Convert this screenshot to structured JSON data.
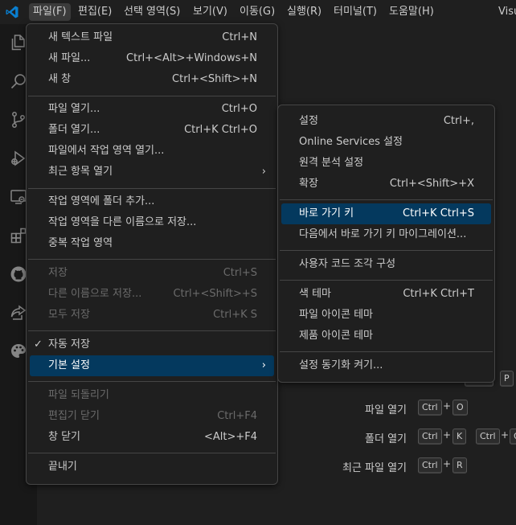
{
  "menubar": {
    "items": [
      "파일(F)",
      "편집(E)",
      "선택 영역(S)",
      "보기(V)",
      "이동(G)",
      "실행(R)",
      "터미널(T)",
      "도움말(H)"
    ],
    "window_title": "Visu"
  },
  "file_menu": {
    "items": [
      {
        "label": "새 텍스트 파일",
        "shortcut": "Ctrl+N"
      },
      {
        "label": "새 파일...",
        "shortcut": "Ctrl+<Alt>+Windows+N"
      },
      {
        "label": "새 창",
        "shortcut": "Ctrl+<Shift>+N"
      },
      {
        "label": "파일 열기...",
        "shortcut": "Ctrl+O"
      },
      {
        "label": "폴더 열기...",
        "shortcut": "Ctrl+K Ctrl+O"
      },
      {
        "label": "파일에서 작업 영역 열기...",
        "shortcut": ""
      },
      {
        "label": "최근 항목 열기",
        "shortcut": ""
      },
      {
        "label": "작업 영역에 폴더 추가...",
        "shortcut": ""
      },
      {
        "label": "작업 영역을 다른 이름으로 저장...",
        "shortcut": ""
      },
      {
        "label": "중복 작업 영역",
        "shortcut": ""
      },
      {
        "label": "저장",
        "shortcut": "Ctrl+S"
      },
      {
        "label": "다른 이름으로 저장...",
        "shortcut": "Ctrl+<Shift>+S"
      },
      {
        "label": "모두 저장",
        "shortcut": "Ctrl+K S"
      },
      {
        "label": "자동 저장",
        "shortcut": ""
      },
      {
        "label": "기본 설정",
        "shortcut": ""
      },
      {
        "label": "파일 되돌리기",
        "shortcut": ""
      },
      {
        "label": "편집기 닫기",
        "shortcut": "Ctrl+F4"
      },
      {
        "label": "창 닫기",
        "shortcut": "<Alt>+F4"
      },
      {
        "label": "끝내기",
        "shortcut": ""
      }
    ],
    "check_mark": "✓",
    "submenu_arrow": "›"
  },
  "preferences_menu": {
    "items": [
      {
        "label": "설정",
        "shortcut": "Ctrl+,"
      },
      {
        "label": "Online Services 설정",
        "shortcut": ""
      },
      {
        "label": "원격 분석 설정",
        "shortcut": ""
      },
      {
        "label": "확장",
        "shortcut": "Ctrl+<Shift>+X"
      },
      {
        "label": "바로 가기 키",
        "shortcut": "Ctrl+K Ctrl+S"
      },
      {
        "label": "다음에서 바로 가기 키 마이그레이션...",
        "shortcut": ""
      },
      {
        "label": "사용자 코드 조각 구성",
        "shortcut": ""
      },
      {
        "label": "색 테마",
        "shortcut": "Ctrl+K Ctrl+T"
      },
      {
        "label": "파일 아이콘 테마",
        "shortcut": ""
      },
      {
        "label": "제품 아이콘 테마",
        "shortcut": ""
      },
      {
        "label": "설정 동기화 켜기...",
        "shortcut": ""
      }
    ]
  },
  "welcome": {
    "plus": "+",
    "rows": [
      {
        "label": "",
        "keys": [
          "P"
        ]
      },
      {
        "label": "파일 열기",
        "keys": [
          "Ctrl",
          "O"
        ]
      },
      {
        "label": "폴더 열기",
        "keys": [
          "Ctrl",
          "K",
          "Ctrl",
          "O"
        ]
      },
      {
        "label": "최근 파일 열기",
        "keys": [
          "Ctrl",
          "R"
        ]
      }
    ]
  },
  "colors": {
    "accent_selected": "#04395e",
    "vscode_blue": "#0a7fd0",
    "menu_background": "#1f1f1f"
  },
  "icons": [
    "vscode-logo-icon",
    "explorer-icon",
    "search-icon",
    "source-control-icon",
    "run-debug-icon",
    "remote-explorer-icon",
    "extensions-icon",
    "github-icon",
    "live-share-icon",
    "palette-icon"
  ]
}
